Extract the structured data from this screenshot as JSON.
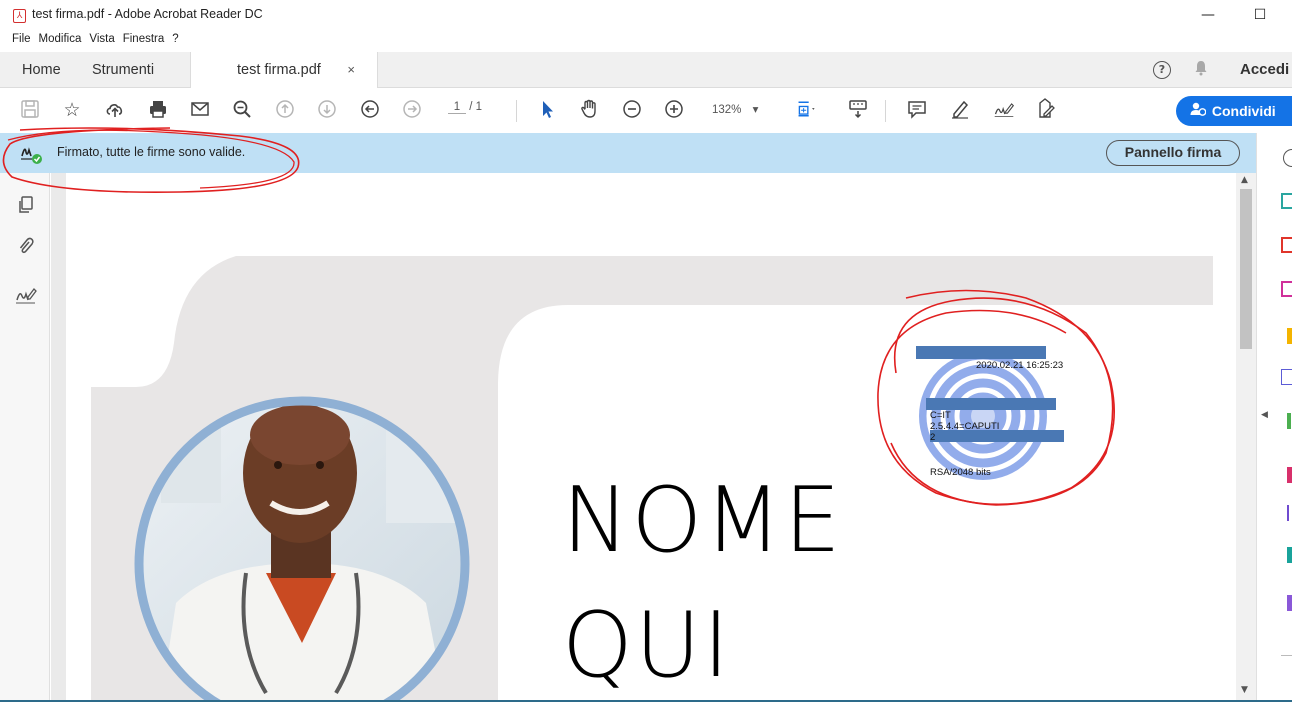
{
  "window": {
    "title": "test firma.pdf - Adobe Acrobat Reader DC",
    "minimize": "—",
    "maximize": "☐"
  },
  "menu": [
    "File",
    "Modifica",
    "Vista",
    "Finestra",
    "?"
  ],
  "tabs": {
    "home": "Home",
    "tools": "Strumenti",
    "document": "test firma.pdf",
    "close": "×",
    "help": "?",
    "signin": "Accedi"
  },
  "toolbar": {
    "page_current": "1",
    "page_total": "/ 1",
    "zoom": "132%",
    "zoom_caret": "▾",
    "share_label": "Condividi"
  },
  "signature_bar": {
    "message": "Firmato, tutte le firme sono valide.",
    "panel_button": "Pannello firma"
  },
  "document": {
    "heading_line1": "NOME",
    "heading_line2": "QUI",
    "stamp": {
      "date": "2020.02.21 16:25:23",
      "country": "C=IT",
      "oid": "2.5.4.4=CAPUTI",
      "extra": "2",
      "key": "RSA/2048 bits"
    }
  },
  "colors": {
    "accent": "#1473e6",
    "banner": "#bfe0f5",
    "annotation": "#e02020",
    "redaction": "#4a78b4",
    "photo_ring": "#8fb0d4"
  }
}
